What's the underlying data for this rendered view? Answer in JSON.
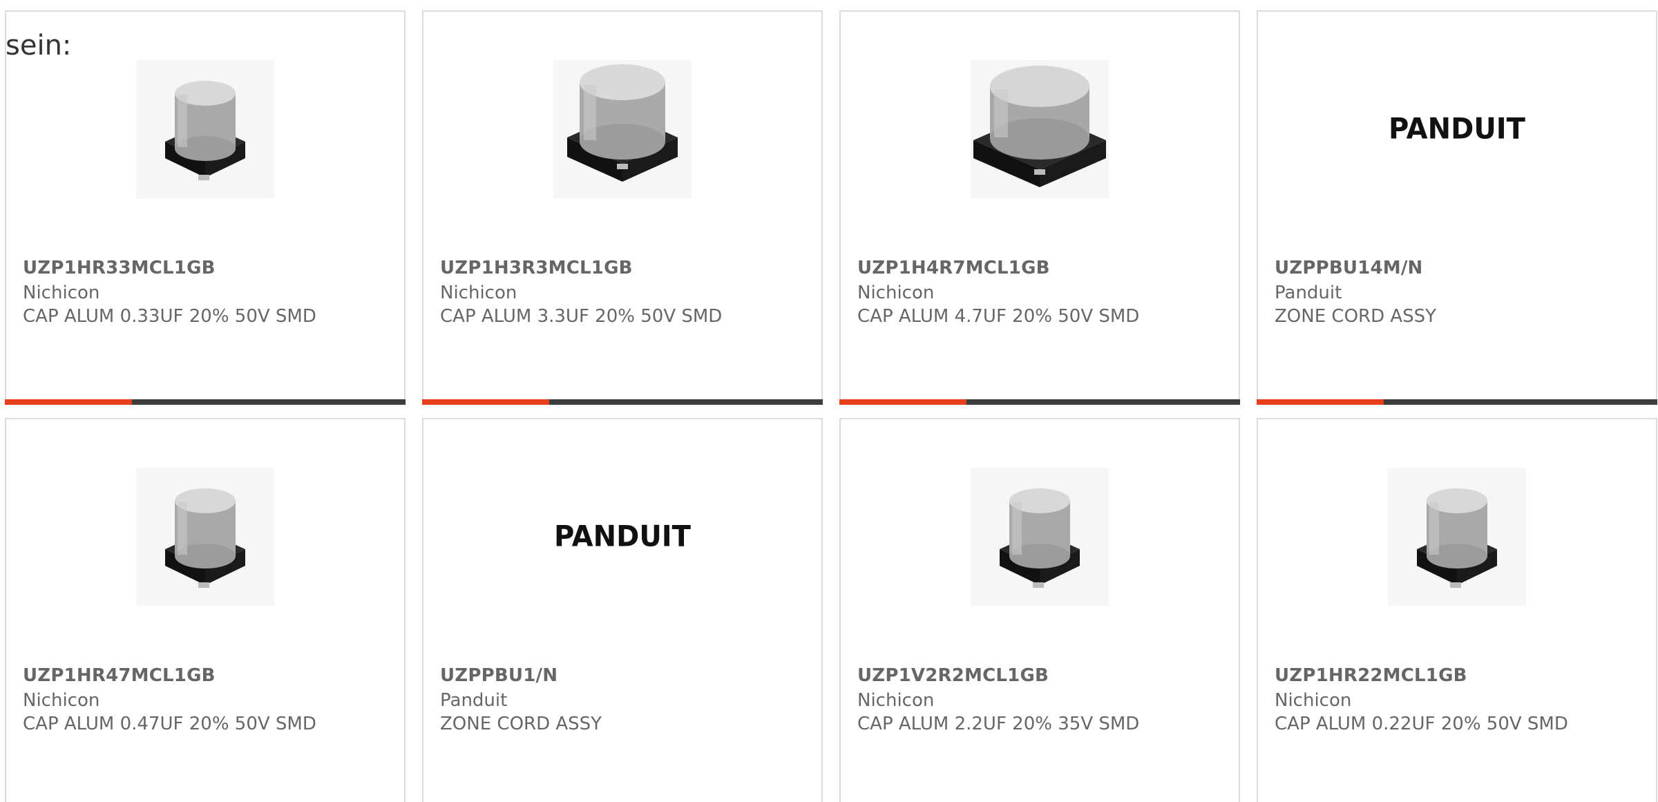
{
  "page": {
    "lead_text": "sein:"
  },
  "colors": {
    "accent": "#e8401c",
    "bar": "#3d3d3d",
    "text": "#666666",
    "border": "#dcdcdc"
  },
  "products": [
    {
      "part_number": "UZP1HR33MCL1GB",
      "manufacturer": "Nichicon",
      "description": "CAP ALUM 0.33UF 20% 50V SMD",
      "image": "capacitor-small-icon"
    },
    {
      "part_number": "UZP1H3R3MCL1GB",
      "manufacturer": "Nichicon",
      "description": "CAP ALUM 3.3UF 20% 50V SMD",
      "image": "capacitor-medium-icon"
    },
    {
      "part_number": "UZP1H4R7MCL1GB",
      "manufacturer": "Nichicon",
      "description": "CAP ALUM 4.7UF 20% 50V SMD",
      "image": "capacitor-large-icon"
    },
    {
      "part_number": "UZPPBU14M/N",
      "manufacturer": "Panduit",
      "description": "ZONE CORD ASSY",
      "image": "panduit-logo",
      "logo_text": "PANDUIT"
    },
    {
      "part_number": "UZP1HR47MCL1GB",
      "manufacturer": "Nichicon",
      "description": "CAP ALUM 0.47UF 20% 50V SMD",
      "image": "capacitor-small-icon"
    },
    {
      "part_number": "UZPPBU1/N",
      "manufacturer": "Panduit",
      "description": "ZONE CORD ASSY",
      "image": "panduit-logo",
      "logo_text": "PANDUIT"
    },
    {
      "part_number": "UZP1V2R2MCL1GB",
      "manufacturer": "Nichicon",
      "description": "CAP ALUM 2.2UF 20% 35V SMD",
      "image": "capacitor-small-icon"
    },
    {
      "part_number": "UZP1HR22MCL1GB",
      "manufacturer": "Nichicon",
      "description": "CAP ALUM 0.22UF 20% 50V SMD",
      "image": "capacitor-small-icon"
    }
  ]
}
